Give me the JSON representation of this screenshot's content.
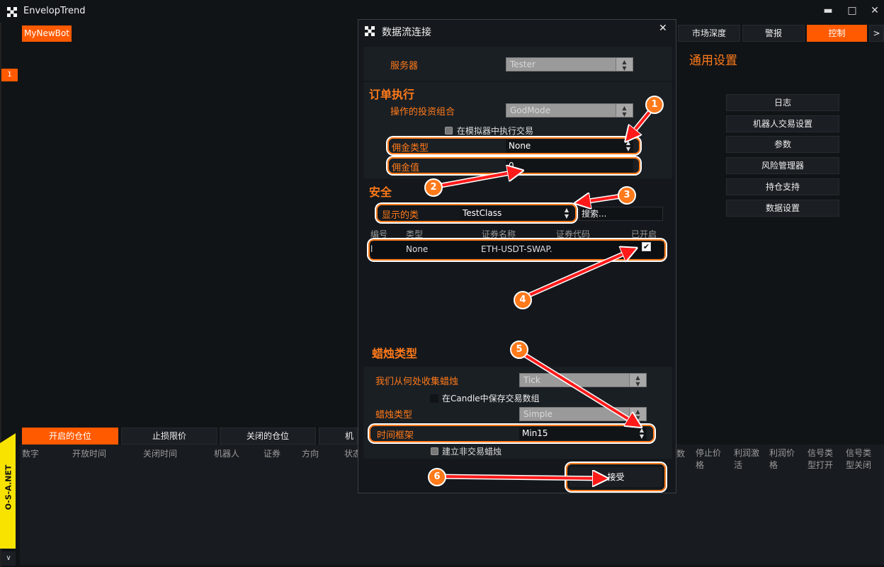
{
  "app": {
    "title": "EnvelopTrend",
    "bot_tab": "MyNewBot",
    "left_tab_marker": "1"
  },
  "window_controls": {
    "minimize": "▬",
    "maximize": "□",
    "close": "✕"
  },
  "top_tabs": [
    "市场深度",
    "警报",
    "控制",
    ">"
  ],
  "right_panel": {
    "title": "通用设置",
    "buttons": [
      "日志",
      "机器人交易设置",
      "参数",
      "风险管理器",
      "持仓支持",
      "数据设置"
    ]
  },
  "bottom_tabs": [
    "开启的仓位",
    "止损限价",
    "关闭的仓位",
    "机器"
  ],
  "bottom_columns_left": [
    "数字",
    "开放时间",
    "关闭时间",
    "机器人",
    "证券",
    "方向",
    "状态"
  ],
  "bottom_columns_right": [
    [
      "数",
      ""
    ],
    [
      "停止价",
      "格"
    ],
    [
      "利润激",
      "活"
    ],
    [
      "利润价",
      "格"
    ],
    [
      "信号类",
      "型打开"
    ],
    [
      "信号类",
      "型关闭"
    ]
  ],
  "side_brand": "O-S-A.NET",
  "side_collapse": "∨",
  "dialog": {
    "title": "数据流连接",
    "close": "✕",
    "server_label": "服务器",
    "server_value": "Tester",
    "order_section": "订单执行",
    "portfolio_label": "操作的投资组合",
    "portfolio_value": "GodMode",
    "emulator_label": "在模拟器中执行交易",
    "commission_type_label": "佣金类型",
    "commission_type_value": "None",
    "commission_value_label": "佣金值",
    "commission_value": "0",
    "security_section": "安全",
    "class_label": "显示的类",
    "class_value": "TestClass",
    "search_placeholder": "搜索...",
    "table_headers": [
      "编号",
      "类型",
      "证券名称",
      "证券代码",
      "已开启"
    ],
    "table_row": {
      "num": "l",
      "type": "None",
      "name": "ETH-USDT-SWAP.",
      "code": "",
      "enabled": true
    },
    "candle_section": "蜡烛类型",
    "candle_source_label": "我们从何处收集蜡烛",
    "candle_source_value": "Tick",
    "save_trades_label": "在Candle中保存交易数组",
    "candle_type_label": "蜡烛类型",
    "candle_type_value": "Simple",
    "timeframe_label": "时间框架",
    "timeframe_value": "Min15",
    "non_trading_label": "建立非交易蜡烛",
    "accept": "接受"
  },
  "callouts": [
    "1",
    "2",
    "3",
    "4",
    "5",
    "6"
  ],
  "colors": {
    "accent": "#ff5a00",
    "background": "#111417",
    "arrow": "#ff1a1a",
    "brand_yellow": "#f8e300"
  }
}
